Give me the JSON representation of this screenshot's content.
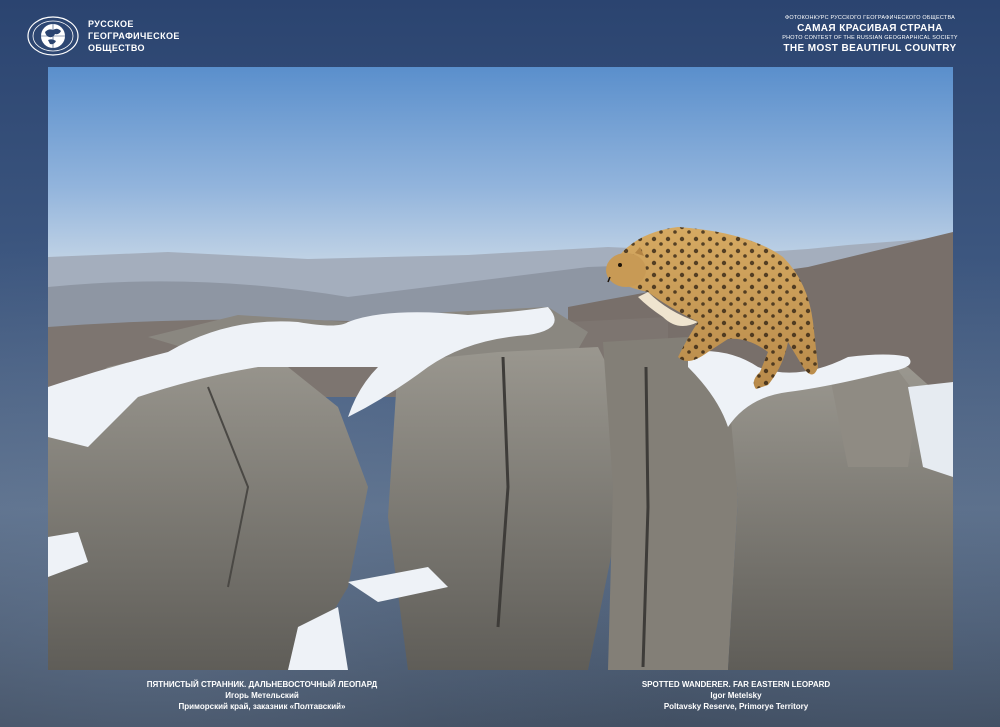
{
  "header": {
    "org_name_lines": [
      "РУССКОЕ",
      "ГЕОГРАФИЧЕСКОЕ",
      "ОБЩЕСТВО"
    ],
    "contest_ru_small": "ФОТОКОНКУРС РУССКОГО ГЕОГРАФИЧЕСКОГО ОБЩЕСТВА",
    "contest_ru_title": "САМАЯ КРАСИВАЯ СТРАНА",
    "contest_en_small": "PHOTO CONTEST OF THE RUSSIAN GEOGRAPHICAL SOCIETY",
    "contest_en_title": "THE MOST BEAUTIFUL COUNTRY"
  },
  "photo": {
    "subject": "far-eastern-leopard-on-snowy-rocks",
    "colors": {
      "sky_top": "#5f93cf",
      "sky_bottom": "#b9cde3",
      "hills": "#8a8f99",
      "rock": "#7c7a74",
      "snow": "#f2f5f8",
      "leopard": "#c79a55"
    }
  },
  "caption_ru": {
    "title": "ПЯТНИСТЫЙ СТРАННИК. ДАЛЬНЕВОСТОЧНЫЙ ЛЕОПАРД",
    "author": "Игорь Метельский",
    "location": "Приморский край, заказник «Полтавский»"
  },
  "caption_en": {
    "title": "SPOTTED WANDERER. FAR EASTERN LEOPARD",
    "author": "Igor Metelsky",
    "location": "Poltavsky Reserve, Primorye Territory"
  }
}
